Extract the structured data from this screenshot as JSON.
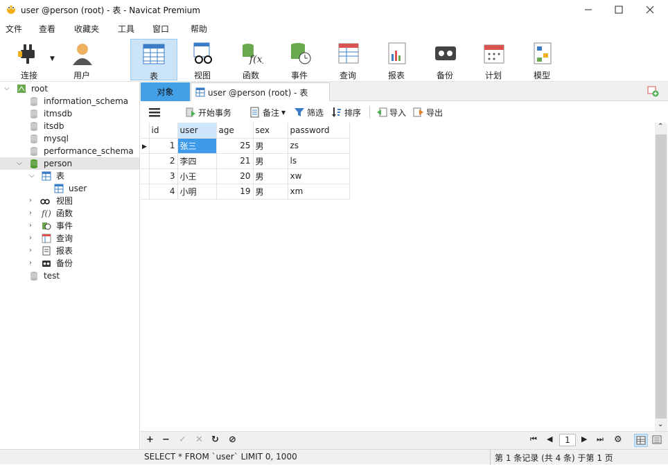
{
  "window": {
    "title": "user @person (root) - 表 - Navicat Premium"
  },
  "menu": [
    "文件",
    "查看",
    "收藏夹",
    "工具",
    "窗口",
    "帮助"
  ],
  "toolbar": {
    "connect": "连接",
    "user": "用户",
    "table": "表",
    "view": "视图",
    "function": "函数",
    "event": "事件",
    "query": "查询",
    "report": "报表",
    "backup": "备份",
    "schedule": "计划",
    "model": "模型"
  },
  "tree": {
    "root": "root",
    "dbs": [
      "information_schema",
      "itmsdb",
      "itsdb",
      "mysql",
      "performance_schema"
    ],
    "person": "person",
    "tables_label": "表",
    "table_user": "user",
    "children": [
      "视图",
      "函数",
      "事件",
      "查询",
      "报表",
      "备份"
    ],
    "test": "test"
  },
  "tabs": {
    "objects": "对象",
    "current": "user @person (root) - 表"
  },
  "tbl_toolbar": {
    "begin_tx": "开始事务",
    "memo": "备注",
    "filter": "筛选",
    "sort": "排序",
    "import": "导入",
    "export": "导出"
  },
  "grid": {
    "columns": [
      "id",
      "user",
      "age",
      "sex",
      "password"
    ],
    "rows": [
      [
        "1",
        "张三",
        "25",
        "男",
        "zs"
      ],
      [
        "2",
        "李四",
        "21",
        "男",
        "ls"
      ],
      [
        "3",
        "小王",
        "20",
        "男",
        "xw"
      ],
      [
        "4",
        "小明",
        "19",
        "男",
        "xm"
      ]
    ]
  },
  "pager": {
    "page": "1"
  },
  "status": {
    "sql": "SELECT * FROM `user` LIMIT 0, 1000",
    "record": "第 1 条记录 (共 4 条) 于第 1 页"
  }
}
